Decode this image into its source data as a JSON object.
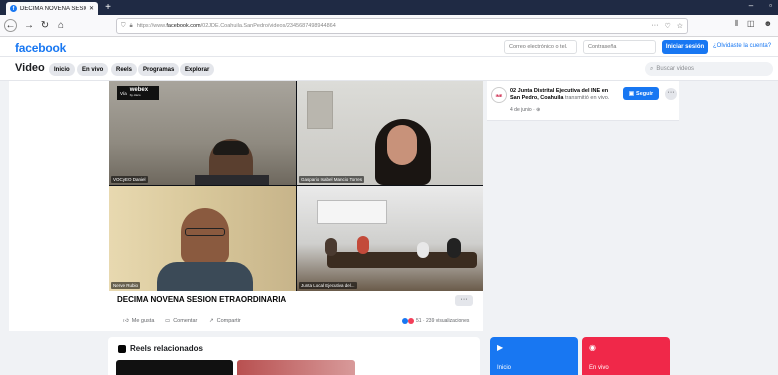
{
  "browser": {
    "tab_title": "DECIMA NOVENA SESION ETC",
    "new_tab": "+",
    "window_controls": [
      "–",
      "▫"
    ],
    "url_prefix": "https://www.",
    "url_domain": "facebook.com",
    "url_path": "/02JDE.Coahuila.SanPedro/videos/2345687498944864",
    "url_actions": [
      "···",
      "♡",
      "☆"
    ],
    "nav_icons": [
      "←",
      "→",
      "↻",
      "⌂"
    ],
    "right_icons": [
      "⫴",
      "◫",
      "☻"
    ]
  },
  "fb_header": {
    "logo": "facebook",
    "email_placeholder": "Correo electrónico o tel.",
    "password_placeholder": "Contraseña",
    "login_button": "Iniciar sesión",
    "forgot_link": "¿Olvidaste la cuenta?"
  },
  "video_nav": {
    "title": "Video",
    "tabs": [
      "Inicio",
      "En vivo",
      "Reels",
      "Programas",
      "Explorar"
    ],
    "search_placeholder": "Buscar videos"
  },
  "video": {
    "webex_badge": "Vía",
    "webex_brand": "webex",
    "webex_sub": "by cisco",
    "participants": [
      "VOCyEO Daniel",
      "Gaspario Isabel Mancio Torres",
      "Nerve Rubio",
      "Junta Local Ejecutiva del..."
    ],
    "title": "DECIMA NOVENA SESION ETRAORDINARIA",
    "more": "···",
    "actions": {
      "like": "Me gusta",
      "comment": "Comentar",
      "share": "Compartir"
    },
    "stats": "51 · 239 visualizaciones"
  },
  "post": {
    "avatar_text": "INE",
    "page_name": "02 Junta Distrital Ejecutiva del INE en San Pedro, Coahuila",
    "transmission": "transmitió en vivo.",
    "date": "4 de junio · ⊕",
    "follow_button": "Seguir",
    "more": "···"
  },
  "reels": {
    "title": "Reels relacionados",
    "cards": [
      {
        "label": "Inicio",
        "icon": "▶"
      },
      {
        "label": "En vivo",
        "icon": "◉"
      }
    ]
  }
}
